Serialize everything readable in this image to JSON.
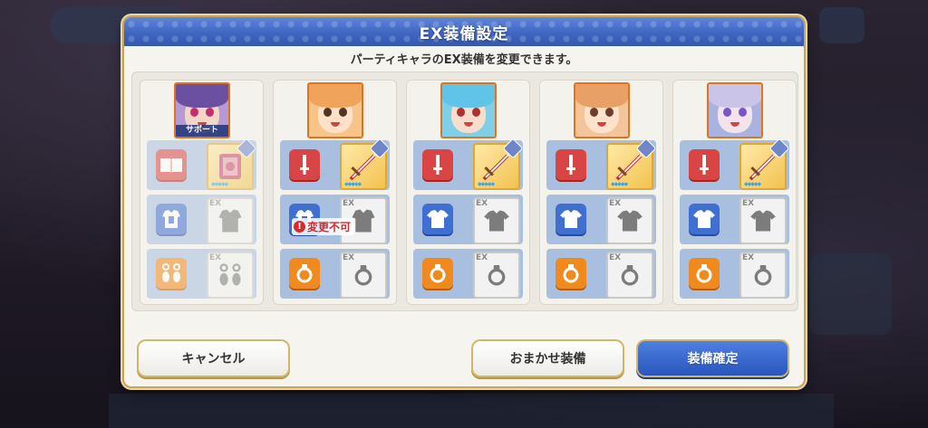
{
  "dialog": {
    "title": "EX装備設定",
    "subtitle": "パーティキャラのEX装備を変更できます。"
  },
  "party": [
    {
      "name": "support-member",
      "support_label": "サポート",
      "colors": {
        "hair": "#6b4fa0",
        "skin": "#f5d5c5",
        "eye": "#c03070",
        "bg": "#b59ad6"
      },
      "slots": [
        "book-icon",
        "armor-icon",
        "earring-icon"
      ],
      "equipped": [
        "spellbook-icon",
        "empty",
        "empty"
      ],
      "locked_label": "変更不可"
    },
    {
      "name": "member-2",
      "colors": {
        "hair": "#f0a35a",
        "skin": "#ffe0c8",
        "eye": "#553322",
        "bg": "#f7c58a"
      },
      "slots": [
        "sword-icon",
        "armor-icon",
        "ring-icon"
      ],
      "equipped": [
        "sword-icon",
        "empty",
        "empty"
      ]
    },
    {
      "name": "member-3",
      "colors": {
        "hair": "#5fc4e8",
        "skin": "#f7ddcc",
        "eye": "#b03030",
        "bg": "#7fcfe8"
      },
      "slots": [
        "sword-icon",
        "shirt-icon",
        "ring-icon"
      ],
      "equipped": [
        "sword-icon",
        "empty",
        "empty"
      ]
    },
    {
      "name": "member-4",
      "colors": {
        "hair": "#e9a066",
        "skin": "#ffe2cc",
        "eye": "#6b3d2a",
        "bg": "#f4c49a"
      },
      "slots": [
        "sword-icon",
        "shirt-icon",
        "ring-icon"
      ],
      "equipped": [
        "sword-icon",
        "empty",
        "empty"
      ]
    },
    {
      "name": "member-5",
      "colors": {
        "hair": "#c9c4e8",
        "skin": "#f3e4ec",
        "eye": "#7a55c9",
        "bg": "#aab3e0"
      },
      "slots": [
        "sword-icon",
        "shirt-icon",
        "ring-icon"
      ],
      "equipped": [
        "sword-icon",
        "empty",
        "empty"
      ]
    }
  ],
  "ex_label": "EX",
  "buttons": {
    "cancel": "キャンセル",
    "auto": "おまかせ装備",
    "confirm": "装備確定"
  },
  "theme": {
    "title_bar": "#3f66c2",
    "accent_gold": "#d2b56a",
    "confirm_blue": "#2856bd",
    "locked_red": "#d62b2b"
  }
}
